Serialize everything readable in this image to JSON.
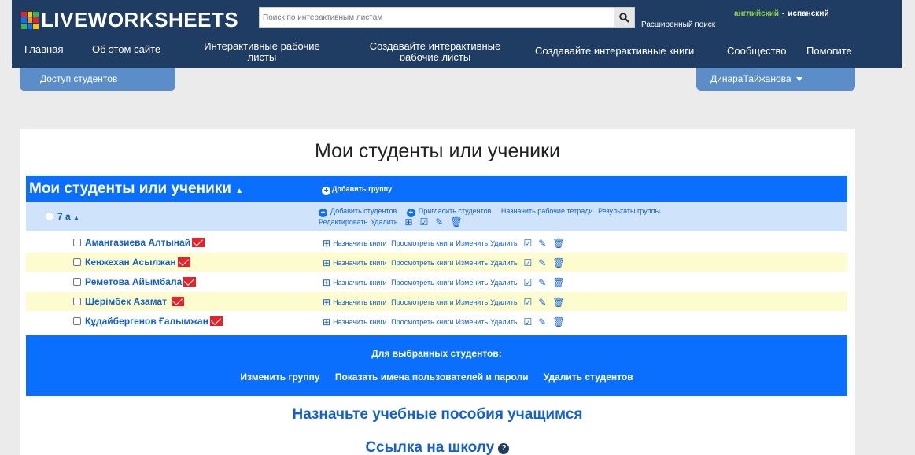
{
  "header": {
    "logo_text": "LIVEWORKSHEETS",
    "search_placeholder": "Поиск по интерактивным листам",
    "advanced_search": "Расширенный поиск",
    "lang_current": "английский",
    "lang_sep": "-",
    "lang_other": "испанский",
    "nav": [
      {
        "label": "Главная"
      },
      {
        "label": "Об этом сайте"
      },
      {
        "label": "Интерактивные рабочие листы"
      },
      {
        "label": "Создавайте интерактивные рабочие листы"
      },
      {
        "label": "Создавайте интерактивные книги"
      },
      {
        "label": "Сообщество"
      },
      {
        "label": "Помогите"
      }
    ]
  },
  "tabs": {
    "student_access": "Доступ студентов",
    "user": "ДинараТайжанова"
  },
  "page": {
    "title": "Мои студенты или ученики",
    "section_title": "Мои студенты или ученики",
    "add_group": "Добавить группу",
    "group": {
      "name": "7 а",
      "actions": {
        "add_students": "Добавить студентов",
        "invite_students": "Пригласить студентов",
        "assign_workbooks": "Назначить рабочие тетради",
        "group_results": "Результаты группы",
        "edit": "Редактировать",
        "delete": "Удалить"
      }
    },
    "student_actions": {
      "assign_books": "Назначить книги",
      "view_books": "Просмотреть книги",
      "edit": "Изменить",
      "delete": "Удалить"
    },
    "students": [
      {
        "name": "Амангазиева Алтынай"
      },
      {
        "name": "Кенжехан Асылжан"
      },
      {
        "name": "Реметова Айымбала"
      },
      {
        "name": "Шерімбек Азамат"
      },
      {
        "name": "Құдайбергенов Ғалымжан"
      }
    ],
    "selected": {
      "title": "Для выбранных студентов:",
      "change_group": "Изменить группу",
      "show_credentials": "Показать имена пользователей и пароли",
      "delete_students": "Удалить студентов"
    },
    "assign_materials": "Назначьте учебные пособия учащимся",
    "school_link": "Ссылка на школу"
  },
  "colors": {
    "topbar": "#1f3c62",
    "accent_blue": "#0a6eff",
    "tab_blue": "#5b8dc9",
    "highlight_row": "#fcfccf",
    "group_row": "#cfe4fb",
    "mail_red": "#e8212b",
    "lang_green": "#8ecf4a"
  },
  "icons": [
    "search-icon",
    "caret-down-icon",
    "plus-circle-icon",
    "mail-icon",
    "assign-books-icon",
    "check-square-icon",
    "edit-icon",
    "trash-icon",
    "question-circle-icon"
  ]
}
